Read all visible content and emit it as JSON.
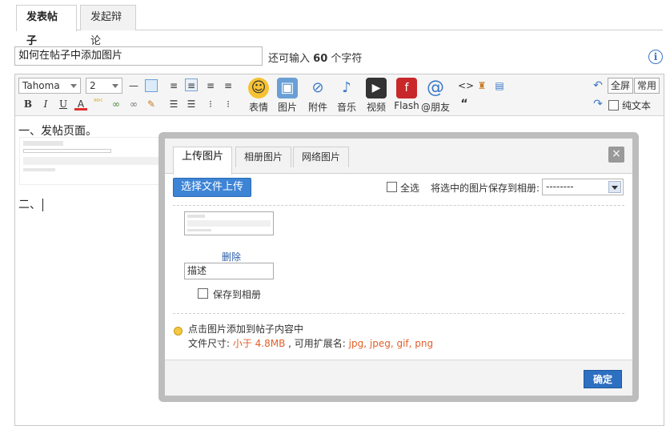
{
  "tabs": [
    "发表帖子",
    "发起辩论"
  ],
  "title_input": {
    "value": "如何在帖子中添加图片"
  },
  "counter": {
    "prefix": "还可输入",
    "count": "60",
    "suffix": "个字符"
  },
  "toolbar": {
    "font": "Tahoma",
    "size": "2",
    "big_buttons": [
      "表情",
      "图片",
      "附件",
      "音乐",
      "视频",
      "Flash",
      "@朋友"
    ],
    "fullscreen": "全屏",
    "common": "常用",
    "plain_text": "纯文本",
    "quote": "“"
  },
  "content": {
    "line1": "一、发帖页面。",
    "line2": "二、"
  },
  "dialog": {
    "tabs": [
      "上传图片",
      "相册图片",
      "网络图片"
    ],
    "close": "×",
    "upload_button": "选择文件上传",
    "select_all": "全选",
    "save_selected_label": "将选中的图片保存到相册:",
    "album_value": "--------",
    "delete_link": "删除",
    "description": "描述",
    "save_to_album": "保存到相册",
    "tip": "点击图片添加到帖子内容中",
    "file_size_label": "文件尺寸: ",
    "file_size_value": "小于 4.8MB",
    "ext_label": " , 可用扩展名: ",
    "ext_value": "jpg, jpeg, gif, png",
    "confirm": "确定"
  }
}
